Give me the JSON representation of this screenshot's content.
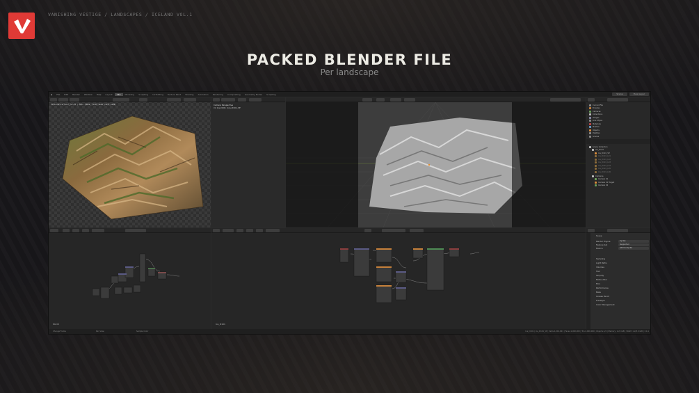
{
  "header": {
    "breadcrumb": "VANISHING VESTIGE / LANDSCAPES / ICELAND VOL.1",
    "title": "PACKED BLENDER FILE",
    "subtitle": "Per landscape"
  },
  "colors": {
    "brand": "#e03a36",
    "terrain_shaded": "#9e9e9e",
    "grid": "#4a6a4a"
  },
  "blender": {
    "menu": [
      "File",
      "Edit",
      "Render",
      "Window",
      "Help"
    ],
    "workspaces": [
      "Layout",
      "TEX",
      "Modeling",
      "Sculpting",
      "UV Editing",
      "Texture Paint",
      "Shading",
      "Animation",
      "Rendering",
      "Compositing",
      "Geometry Nodes",
      "Scripting"
    ],
    "active_workspace": "TEX",
    "scene_selector": "Scene",
    "view_layer": "View Layer",
    "image_path": "Textures\\Terrain\\_14\\14 | Main (4029, 7158) Node (3471,3499)",
    "camera_label_1": "Camera Perspective",
    "camera_label_2": "(1) Ice_D101 | Ice_D101_VP",
    "outliner": {
      "top_items": [
        "Current File",
        "Brushes",
        "Cameras",
        "Collections",
        "Images",
        "Line Styles",
        "Materials",
        "Meshes",
        "Objects",
        "Palettes",
        "Scenes"
      ],
      "scene_collection": "Scene Collection",
      "tree": [
        "Ice_D101",
        "Ice_D101_VP",
        "Ice_D101_L01",
        "Ice_D101_L02",
        "Ice_D101_L03",
        "Ice_D101_L04",
        "Ice_D101_L05",
        "Ice_D101_L06",
        "Cameras",
        "Camera 01",
        "Camera 01 Target",
        "Camera 02"
      ]
    },
    "node_editor_left_name": "World",
    "node_editor_right_name": "Ice_D101",
    "properties": {
      "scene": "Scene",
      "render_engine_label": "Render Engine",
      "render_engine": "Cycles",
      "feature_set_label": "Feature Set",
      "feature_set": "Supported",
      "device_label": "Device",
      "device": "GPU Compute",
      "sections": [
        "Sampling",
        "Light Paths",
        "Volumes",
        "Hair",
        "Simplify",
        "Motion Blur",
        "Film",
        "Performance",
        "Bake",
        "Grease Pencil",
        "Freestyle",
        "Color Management"
      ]
    },
    "status": {
      "left": "Change Frame",
      "mid": "Pan View",
      "right_left": "Sample Color",
      "right": "Ice_D101 | Ice_D101_VP | Verts:1,001,001 | Faces:1,000,000 | Tris:2,000,000 | Objects:1/4 | Memory: 1.22 GiB | VRAM: 1.2/8.0 GiB | 3.4.1"
    }
  }
}
